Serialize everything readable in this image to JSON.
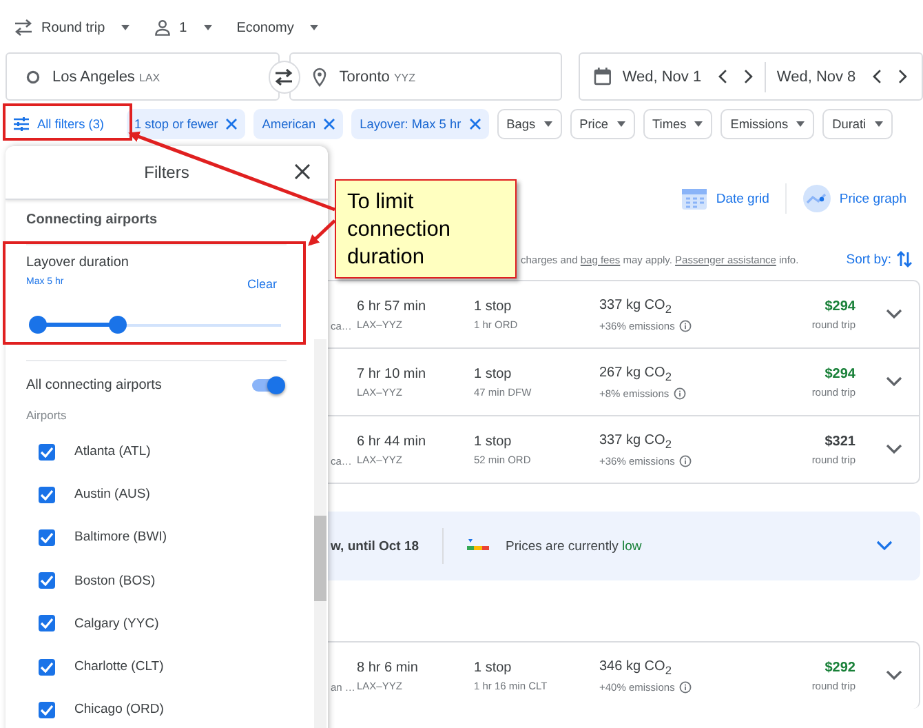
{
  "trip_options": {
    "trip_type": "Round trip",
    "passengers": "1",
    "cabin": "Economy"
  },
  "search": {
    "origin": {
      "value": "Los Angeles",
      "code": "LAX"
    },
    "destination": {
      "value": "Toronto",
      "code": "YYZ"
    },
    "departure": "Wed, Nov 1",
    "return": "Wed, Nov 8"
  },
  "filter_chips": [
    {
      "label": "All filters (3)",
      "kind": "all"
    },
    {
      "label": "1 stop or fewer",
      "kind": "applied"
    },
    {
      "label": "American",
      "kind": "applied"
    },
    {
      "label": "Layover: Max 5 hr",
      "kind": "applied"
    },
    {
      "label": "Bags",
      "kind": "dropdown"
    },
    {
      "label": "Price",
      "kind": "dropdown"
    },
    {
      "label": "Times",
      "kind": "dropdown"
    },
    {
      "label": "Emissions",
      "kind": "dropdown"
    },
    {
      "label": "Durati",
      "kind": "dropdown"
    }
  ],
  "filters_panel": {
    "title": "Filters",
    "section": "Connecting airports",
    "layover": {
      "label": "Layover duration",
      "reading": "Max 5 hr",
      "clear": "Clear",
      "level": 0.33
    },
    "all_airports": {
      "label": "All connecting airports",
      "on": true
    },
    "airports_heading": "Airports",
    "airports": [
      {
        "label": "Atlanta (ATL)",
        "checked": true
      },
      {
        "label": "Austin (AUS)",
        "checked": true
      },
      {
        "label": "Baltimore (BWI)",
        "checked": true
      },
      {
        "label": "Boston (BOS)",
        "checked": true
      },
      {
        "label": "Calgary (YYC)",
        "checked": true
      },
      {
        "label": "Charlotte (CLT)",
        "checked": true
      },
      {
        "label": "Chicago (ORD)",
        "checked": true
      }
    ]
  },
  "view_buttons": {
    "date_grid": "Date grid",
    "price_graph": "Price graph"
  },
  "notice": {
    "before": "charges and",
    "link_1": "bag fees",
    "middle": "may apply.",
    "link_2": "Passenger assistance",
    "after": "info."
  },
  "sort_label": "Sort by:",
  "flights": [
    {
      "airline": "ca…",
      "duration": "6 hr 57 min",
      "route": "LAX–YYZ",
      "stops": "1 stop",
      "layover": "1 hr ORD",
      "emissions": "337 kg CO$_{2}$",
      "emissions_delta": "+36% emissions",
      "price": "$294",
      "price_note": "round trip",
      "highlighted": true
    },
    {
      "duration": "7 hr 10 min",
      "route": "LAX–YYZ",
      "stops": "1 stop",
      "layover": "47 min DFW",
      "emissions": "267 kg CO$_{2}$",
      "emissions_delta": "+8% emissions",
      "price": "$294",
      "price_note": "round trip",
      "highlighted": true
    },
    {
      "airline": "ca…",
      "duration": "6 hr 44 min",
      "route": "LAX–YYZ",
      "stops": "1 stop",
      "layover": "52 min ORD",
      "emissions": "337 kg CO$_{2}$",
      "emissions_delta": "+36% emissions",
      "price": "$321",
      "price_note": "round trip",
      "highlighted": false
    }
  ],
  "price_insight": {
    "text": "w, until Oct 18",
    "status_prefix": "Prices are currently",
    "status": "low"
  },
  "more_flights": [
    {
      "airline": "an …",
      "duration": "8 hr 6 min",
      "route": "LAX–YYZ",
      "stops": "1 stop",
      "layover": "1 hr 16 min CLT",
      "emissions": "346 kg CO$_{2}$",
      "emissions_delta": "+40% emissions",
      "price": "$292",
      "price_note": "round trip",
      "highlighted": true
    }
  ],
  "callout": {
    "text": "To limit connection duration"
  }
}
